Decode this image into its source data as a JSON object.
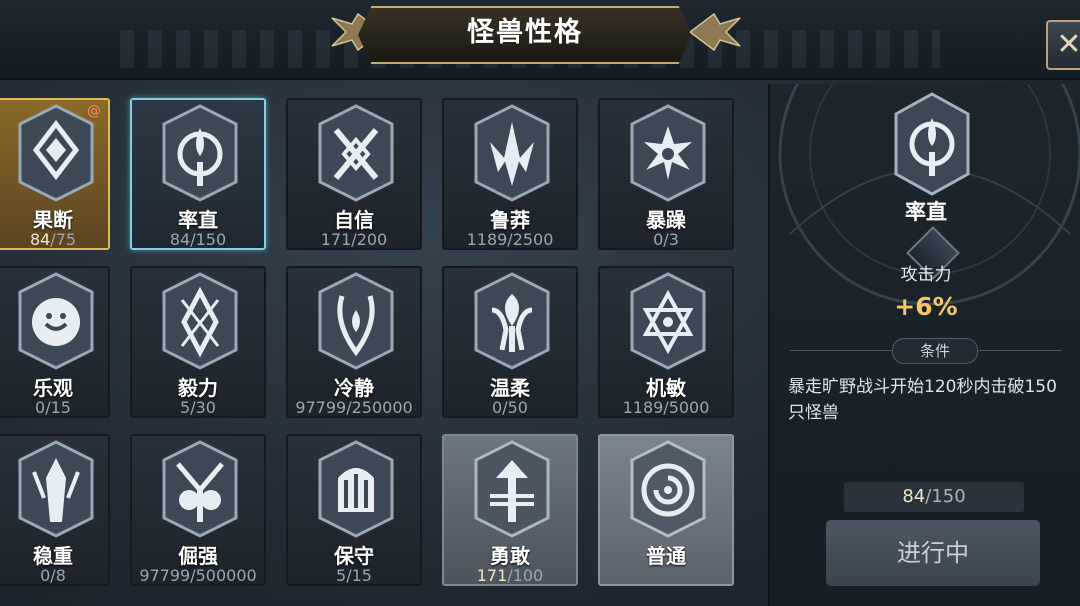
{
  "header": {
    "title": "怪兽性格"
  },
  "traits": [
    {
      "name": "果断",
      "current": "84",
      "total": "75",
      "icon": "diamond-lattice-emblem-icon"
    },
    {
      "name": "率直",
      "current": "84",
      "total": "150",
      "icon": "drop-circle-emblem-icon"
    },
    {
      "name": "自信",
      "current": "171",
      "total": "200",
      "icon": "x-knot-emblem-icon"
    },
    {
      "name": "鲁莽",
      "current": "1189",
      "total": "2500",
      "icon": "claw-emblem-icon"
    },
    {
      "name": "暴躁",
      "current": "0",
      "total": "3",
      "icon": "star-burst-emblem-icon"
    },
    {
      "name": "乐观",
      "current": "0",
      "total": "15",
      "icon": "sun-face-emblem-icon"
    },
    {
      "name": "毅力",
      "current": "5",
      "total": "30",
      "icon": "crossed-blades-emblem-icon"
    },
    {
      "name": "冷静",
      "current": "97799",
      "total": "250000",
      "icon": "flame-drop-emblem-icon"
    },
    {
      "name": "温柔",
      "current": "0",
      "total": "50",
      "icon": "lotus-emblem-icon"
    },
    {
      "name": "机敏",
      "current": "1189",
      "total": "5000",
      "icon": "hexagram-emblem-icon"
    },
    {
      "name": "稳重",
      "current": "0",
      "total": "8",
      "icon": "pillar-emblem-icon"
    },
    {
      "name": "倔强",
      "current": "97799",
      "total": "500000",
      "icon": "horned-mask-emblem-icon"
    },
    {
      "name": "保守",
      "current": "5",
      "total": "15",
      "icon": "helmet-emblem-icon"
    },
    {
      "name": "勇敢",
      "current": "171",
      "total": "100",
      "icon": "arrow-up-emblem-icon"
    },
    {
      "name": "普通",
      "current": "",
      "total": "",
      "icon": "spiral-emblem-icon"
    }
  ],
  "selected": {
    "name": "率直",
    "attribute_label": "攻击力",
    "attribute_value": "+6%",
    "condition_tag": "条件",
    "condition_text": "暴走旷野战斗开始120秒内击破150只怪兽",
    "progress_current": "84",
    "progress_total": "150",
    "status_button": "进行中"
  },
  "colors": {
    "gold": "#f6c766",
    "active_border": "#7fd0e2",
    "muted": "#9ba6b0"
  }
}
